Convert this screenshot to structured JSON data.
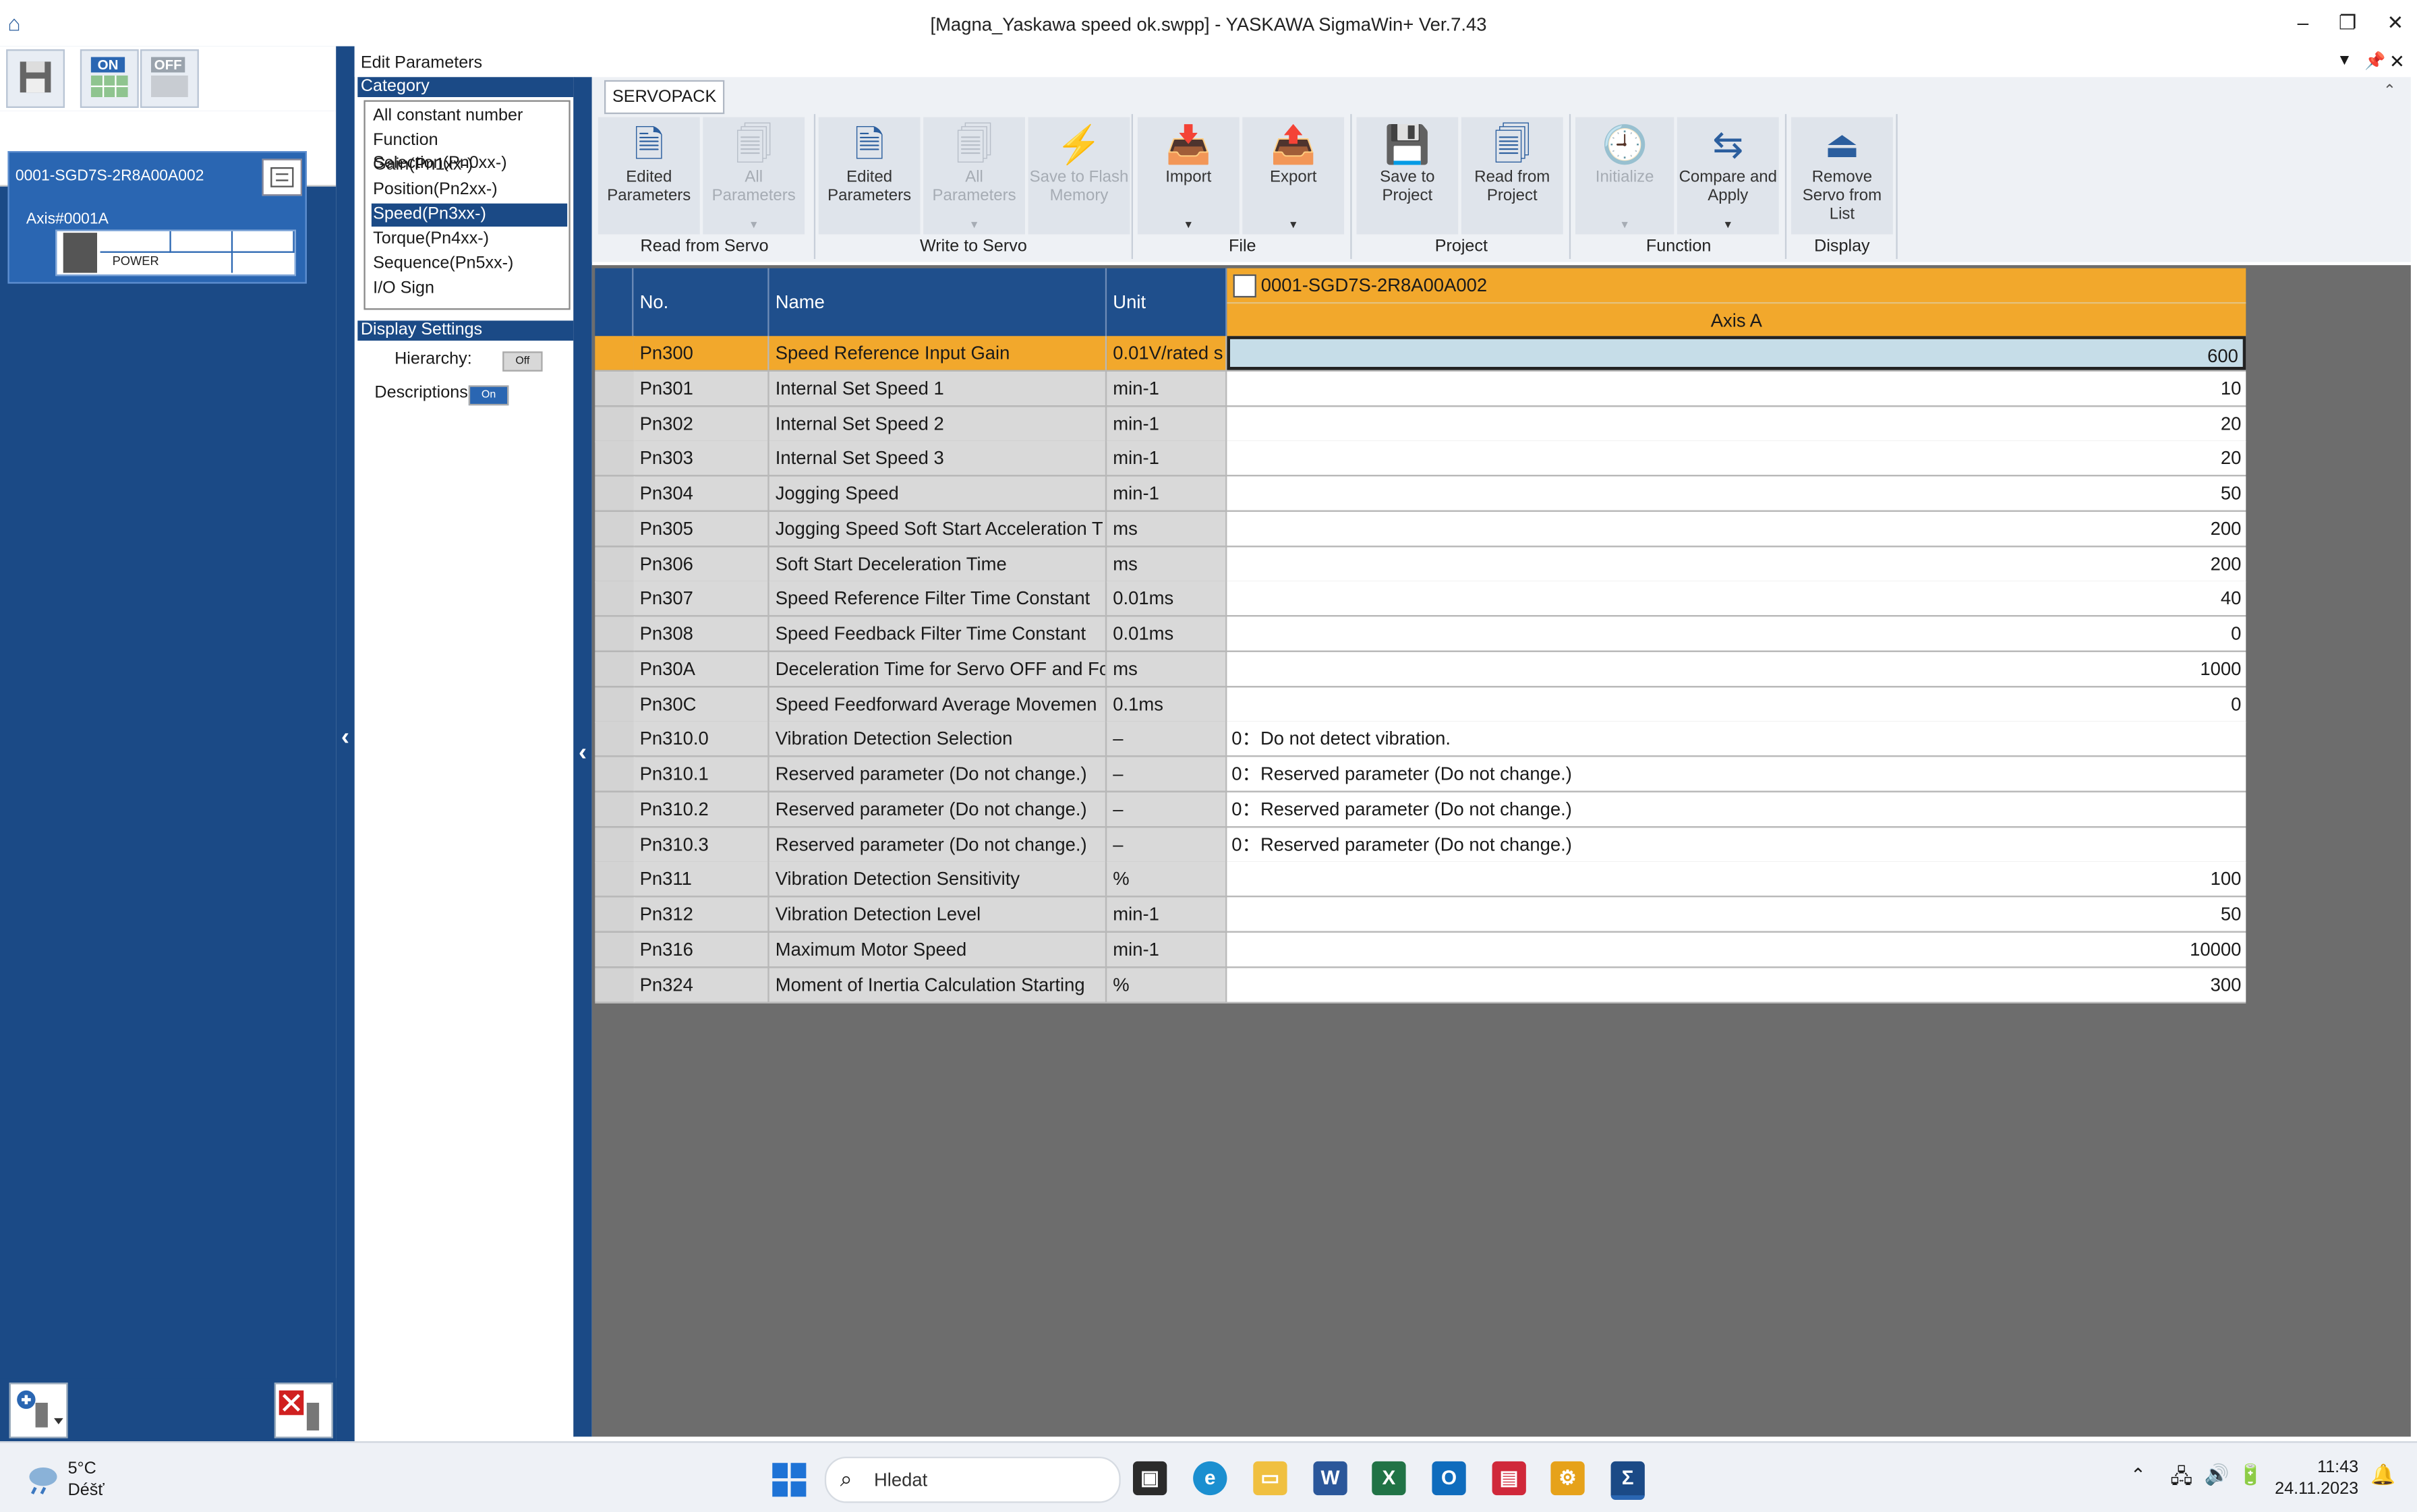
{
  "window": {
    "title": "[Magna_Yaskawa speed ok.swpp] - YASKAWA SigmaWin+ Ver.7.43",
    "buttons": {
      "minimize": "–",
      "restore": "❐",
      "close": "✕"
    }
  },
  "left_toolbar": {
    "on_label": "ON",
    "off_label": "OFF"
  },
  "device": {
    "name": "0001-SGD7S-2R8A00A002",
    "axis": "Axis#0001A",
    "power": "POWER"
  },
  "edit_params": {
    "title": "Edit Parameters"
  },
  "category": {
    "header": "Category",
    "items": [
      "All constant number",
      "Function Selection(Pn0xx-)",
      "Gain(Pn1xx-)",
      "Position(Pn2xx-)",
      "Speed(Pn3xx-)",
      "Torque(Pn4xx-)",
      "Sequence(Pn5xx-)",
      "I/O Sign"
    ],
    "selected": "Speed(Pn3xx-)"
  },
  "display_settings": {
    "header": "Display Settings",
    "hierarchy_label": "Hierarchy:",
    "hierarchy_state": "Off",
    "descriptions_label": "Descriptions:",
    "descriptions_state": "On"
  },
  "ribbon": {
    "tab": "SERVOPACK",
    "groups": [
      {
        "label": "Read from Servo",
        "buttons": [
          "Edited Parameters",
          "All Parameters"
        ]
      },
      {
        "label": "Write to Servo",
        "buttons": [
          "Edited Parameters",
          "All Parameters",
          "Save to Flash Memory"
        ]
      },
      {
        "label": "File",
        "buttons": [
          "Import",
          "Export"
        ]
      },
      {
        "label": "Project",
        "buttons": [
          "Save to Project",
          "Read from Project"
        ]
      },
      {
        "label": "Function",
        "buttons": [
          "Initialize",
          "Compare and Apply"
        ]
      },
      {
        "label": "Display",
        "buttons": [
          "Remove Servo from List"
        ]
      }
    ]
  },
  "table": {
    "headers": {
      "no": "No.",
      "name": "Name",
      "unit": "Unit"
    },
    "device_header": "0001-SGD7S-2R8A00A002",
    "axis_header": "Axis A",
    "rows": [
      {
        "no": "Pn300",
        "name": "Speed Reference Input Gain",
        "unit": "0.01V/rated s",
        "value": "600"
      },
      {
        "no": "Pn301",
        "name": "Internal Set Speed 1",
        "unit": "min-1",
        "value": "10"
      },
      {
        "no": "Pn302",
        "name": "Internal Set Speed 2",
        "unit": "min-1",
        "value": "20"
      },
      {
        "no": "Pn303",
        "name": "Internal Set Speed 3",
        "unit": "min-1",
        "value": "20"
      },
      {
        "no": "Pn304",
        "name": "Jogging Speed",
        "unit": "min-1",
        "value": "50"
      },
      {
        "no": "Pn305",
        "name": "Jogging Speed Soft Start Acceleration T",
        "unit": "ms",
        "value": "200"
      },
      {
        "no": "Pn306",
        "name": "Soft Start Deceleration Time",
        "unit": "ms",
        "value": "200"
      },
      {
        "no": "Pn307",
        "name": "Speed Reference Filter Time Constant",
        "unit": "0.01ms",
        "value": "40"
      },
      {
        "no": "Pn308",
        "name": "Speed Feedback Filter Time Constant",
        "unit": "0.01ms",
        "value": "0"
      },
      {
        "no": "Pn30A",
        "name": "Deceleration Time for Servo OFF and Fo",
        "unit": "ms",
        "value": "1000"
      },
      {
        "no": "Pn30C",
        "name": "Speed Feedforward Average Movemen",
        "unit": "0.1ms",
        "value": "0"
      },
      {
        "no": "Pn310.0",
        "name": "Vibration Detection Selection",
        "unit": "–",
        "value": "0：Do not detect vibration."
      },
      {
        "no": "Pn310.1",
        "name": "Reserved parameter (Do not change.)",
        "unit": "–",
        "value": "0：Reserved parameter (Do not change.)"
      },
      {
        "no": "Pn310.2",
        "name": "Reserved parameter (Do not change.)",
        "unit": "–",
        "value": "0：Reserved parameter (Do not change.)"
      },
      {
        "no": "Pn310.3",
        "name": "Reserved parameter (Do not change.)",
        "unit": "–",
        "value": "0：Reserved parameter (Do not change.)"
      },
      {
        "no": "Pn311",
        "name": "Vibration Detection Sensitivity",
        "unit": "%",
        "value": "100"
      },
      {
        "no": "Pn312",
        "name": "Vibration Detection Level",
        "unit": "min-1",
        "value": "50"
      },
      {
        "no": "Pn316",
        "name": "Maximum Motor Speed",
        "unit": "min-1",
        "value": "10000"
      },
      {
        "no": "Pn324",
        "name": "Moment of Inertia Calculation Starting",
        "unit": "%",
        "value": "300"
      }
    ]
  },
  "taskbar": {
    "weather_temp": "5°C",
    "weather_desc": "Déšť",
    "search_placeholder": "Hledat",
    "time": "11:43",
    "date": "24.11.2023"
  }
}
